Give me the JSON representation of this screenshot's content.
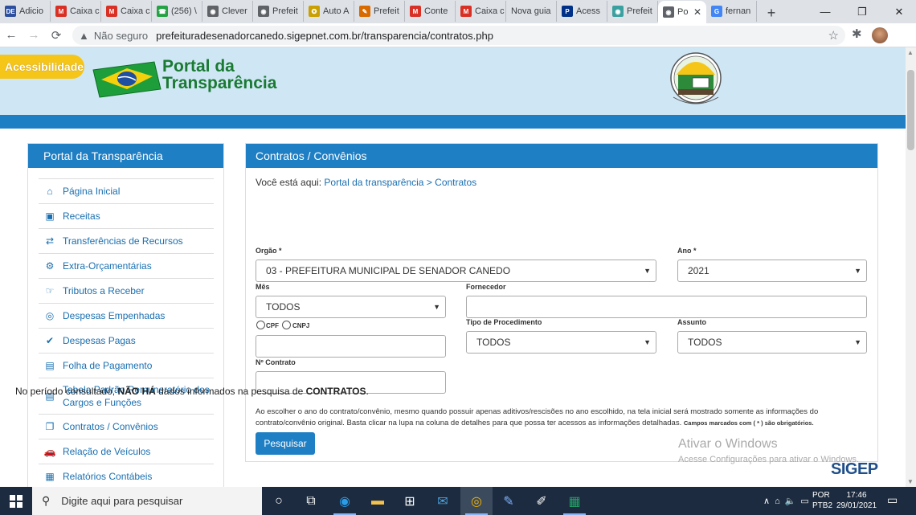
{
  "browser": {
    "tabs": [
      {
        "label": "Adicio",
        "icon": "de-icon",
        "color": "#2d4f9e",
        "glyph": "DE"
      },
      {
        "label": "Caixa c",
        "icon": "gmail-icon",
        "color": "#d93025",
        "glyph": "M"
      },
      {
        "label": "Caixa c",
        "icon": "gmail-icon",
        "color": "#d93025",
        "glyph": "M"
      },
      {
        "label": "(256) \\",
        "icon": "whatsapp-icon",
        "color": "#25a244",
        "glyph": "☎"
      },
      {
        "label": "Clever",
        "icon": "globe-icon",
        "color": "#5f6368",
        "glyph": "◉"
      },
      {
        "label": "Prefeit",
        "icon": "globe-icon",
        "color": "#5f6368",
        "glyph": "◉"
      },
      {
        "label": "Auto A",
        "icon": "govbr-icon",
        "color": "#c9a000",
        "glyph": "✪"
      },
      {
        "label": "Prefeit",
        "icon": "pen-icon",
        "color": "#d86a00",
        "glyph": "✎"
      },
      {
        "label": "Conte",
        "icon": "gmail-icon",
        "color": "#d93025",
        "glyph": "M"
      },
      {
        "label": "Caixa c",
        "icon": "gmail-icon",
        "color": "#d93025",
        "glyph": "M"
      },
      {
        "label": "Nova guia",
        "icon": "",
        "color": "",
        "glyph": ""
      },
      {
        "label": "Acess",
        "icon": "paypal-icon",
        "color": "#003087",
        "glyph": "P"
      },
      {
        "label": "Prefeit",
        "icon": "globe-icon",
        "color": "#3aa0a0",
        "glyph": "◉"
      },
      {
        "label": "Po",
        "icon": "globe-icon",
        "color": "#5f6368",
        "glyph": "◉",
        "active": true
      },
      {
        "label": "fernan",
        "icon": "google-icon",
        "color": "#4285f4",
        "glyph": "G"
      }
    ],
    "insecure_label": "Não seguro",
    "url": "prefeituradesenadorcanedo.sigepnet.com.br/transparencia/contratos.php"
  },
  "site": {
    "accessibility_label": "Acessibilidade",
    "title_line1": "Portal da",
    "title_line2": "Transparência"
  },
  "sidebar": {
    "title": "Portal da Transparência",
    "items": [
      {
        "label": "Página Inicial",
        "icon": "home-icon",
        "glyph": "⌂"
      },
      {
        "label": "Receitas",
        "icon": "money-icon",
        "glyph": "▣"
      },
      {
        "label": "Transferências de Recursos",
        "icon": "exchange-icon",
        "glyph": "⇄"
      },
      {
        "label": "Extra-Orçamentárias",
        "icon": "gear-icon",
        "glyph": "⚙"
      },
      {
        "label": "Tributos a Receber",
        "icon": "hand-icon",
        "glyph": "☞"
      },
      {
        "label": "Despesas Empenhadas",
        "icon": "coins-icon",
        "glyph": "◎"
      },
      {
        "label": "Despesas Pagas",
        "icon": "check-circle-icon",
        "glyph": "✔"
      },
      {
        "label": "Folha de Pagamento",
        "icon": "id-card-icon",
        "glyph": "▤"
      },
      {
        "label": "Tabela Padrão Remuneratório dos Cargos e Funções",
        "icon": "id-card-icon",
        "glyph": "▤"
      },
      {
        "label": "Contratos / Convênios",
        "icon": "copy-icon",
        "glyph": "❐"
      },
      {
        "label": "Relação de Veículos",
        "icon": "car-icon",
        "glyph": "🚗"
      },
      {
        "label": "Relatórios Contábeis",
        "icon": "report-icon",
        "glyph": "▦"
      }
    ]
  },
  "main": {
    "title": "Contratos / Convênios",
    "breadcrumb_prefix": "Você está aqui:",
    "breadcrumb_link": "Portal da transparência > Contratos",
    "form": {
      "orgao_label": "Orgão *",
      "orgao_value": "03 - PREFEITURA MUNICIPAL DE SENADOR CANEDO",
      "ano_label": "Ano *",
      "ano_value": "2021",
      "mes_label": "Mês",
      "mes_value": "TODOS",
      "fornecedor_label": "Fornecedor",
      "fornecedor_value": "",
      "cpf_label": "CPF",
      "cnpj_label": "CNPJ",
      "doc_value": "",
      "tipo_label": "Tipo de Procedimento",
      "tipo_value": "TODOS",
      "assunto_label": "Assunto",
      "assunto_value": "TODOS",
      "ncontrato_label": "Nº Contrato",
      "ncontrato_value": ""
    },
    "notice": "Ao escolher o ano do contrato/convênio, mesmo quando possuir apenas aditivos/rescisões no ano escolhido, na tela inicial será mostrado somente as informações do contrato/convênio original. Basta clicar na lupa na coluna de detalhes para que possa ter acessos as informações detalhadas.",
    "notice_required": "Campos marcados com ( * ) são obrigatórios.",
    "search_button": "Pesquisar",
    "result_prefix": "No período consultado,",
    "result_bold1": "NÃO HÁ",
    "result_mid": "dados informados na pesquisa de",
    "result_bold2": "CONTRATOS",
    "result_suffix": "."
  },
  "watermark": {
    "line1": "Ativar o Windows",
    "line2": "Acesse Configurações para ativar o Windows."
  },
  "sigep_logo": "SIGEP",
  "taskbar": {
    "search_placeholder": "Digite aqui para pesquisar",
    "lang_line1": "POR",
    "lang_line2": "PTB2",
    "time": "17:46",
    "date": "29/01/2021"
  }
}
